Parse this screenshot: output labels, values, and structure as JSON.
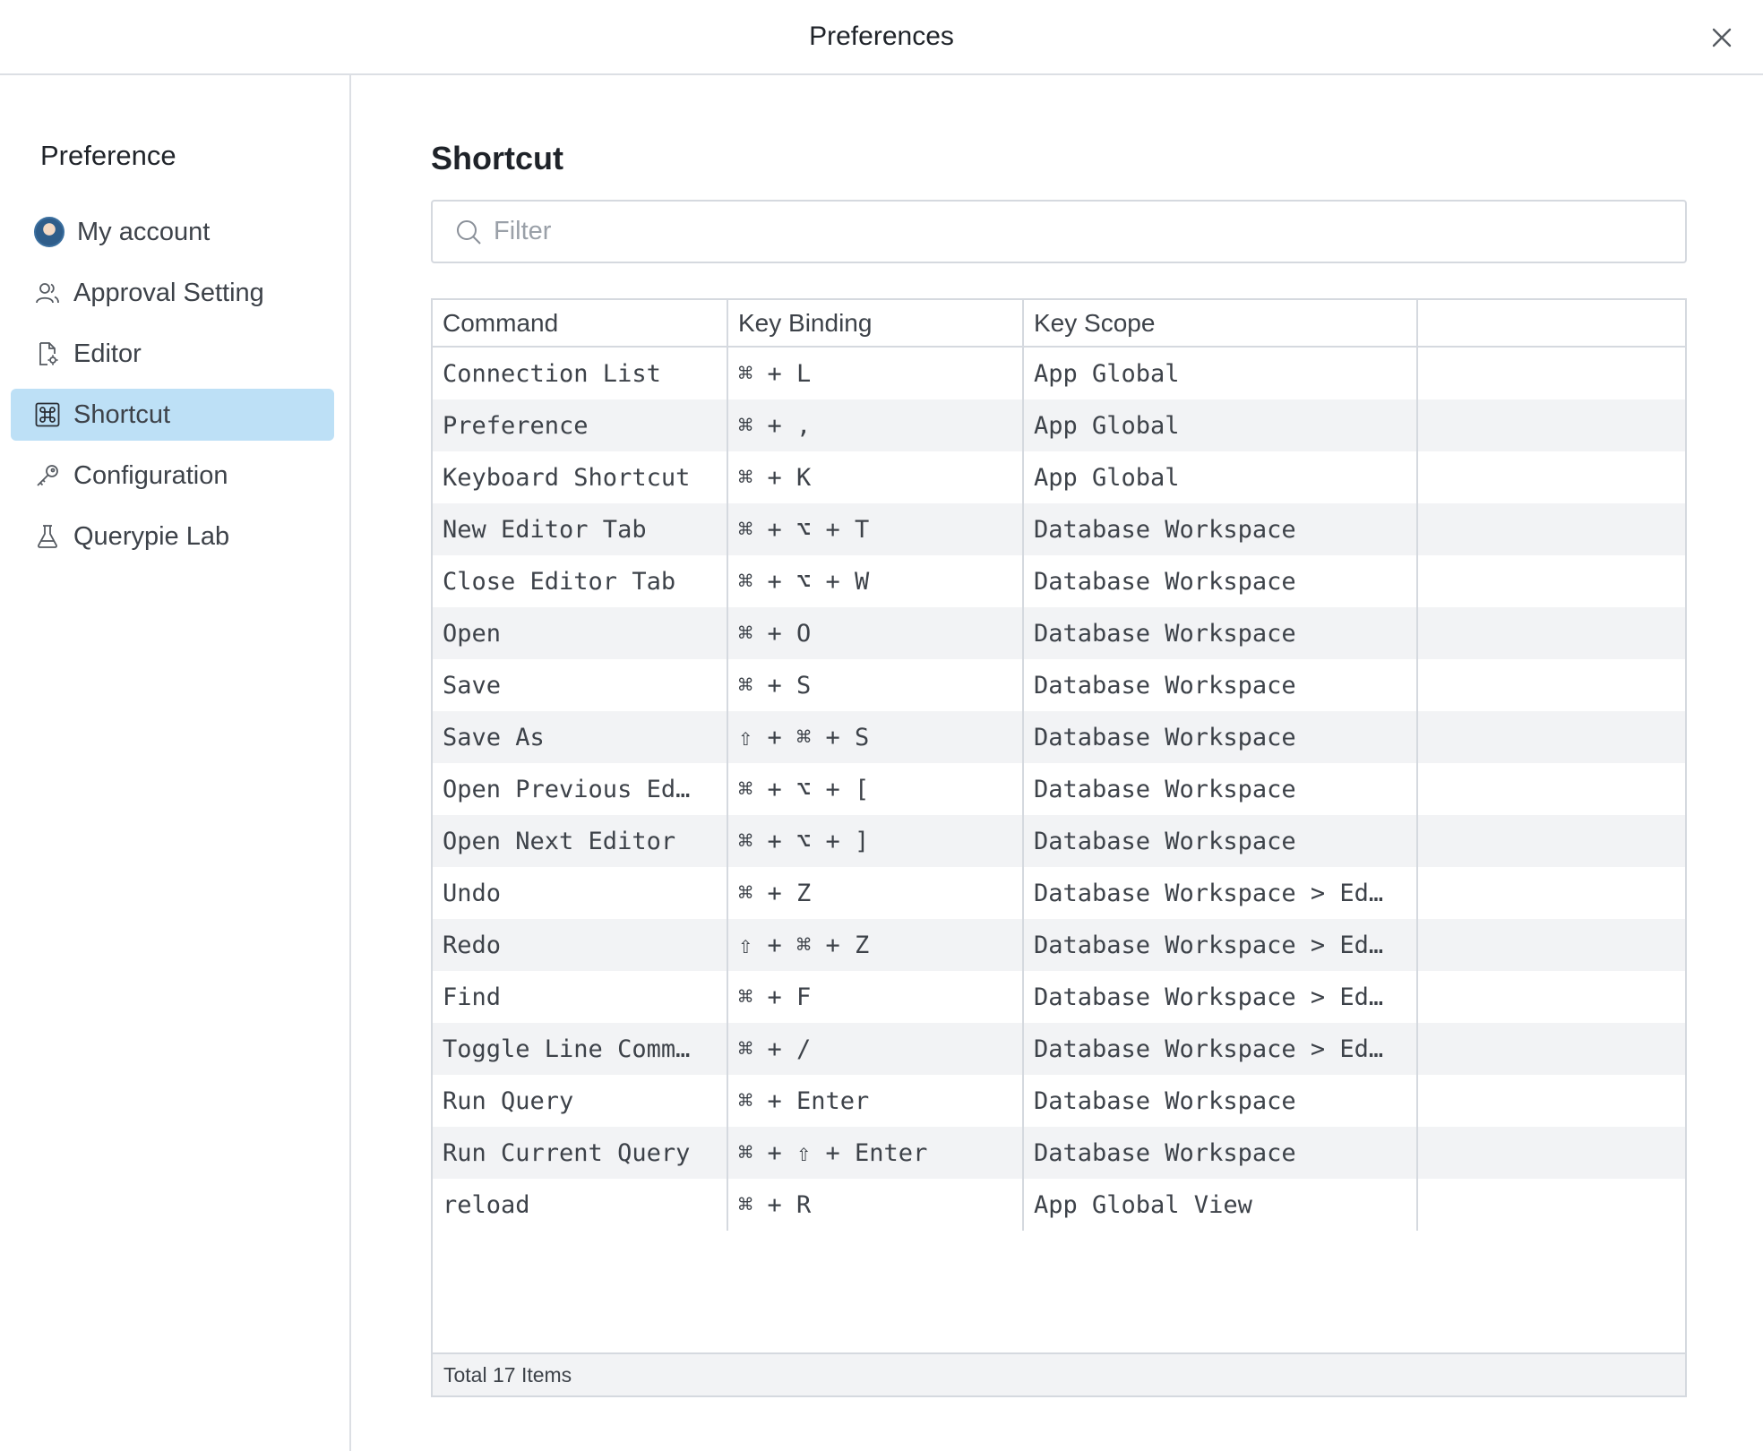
{
  "window": {
    "title": "Preferences"
  },
  "sidebar": {
    "heading": "Preference",
    "items": [
      {
        "label": "My account",
        "icon": "avatar-icon",
        "active": false
      },
      {
        "label": "Approval Setting",
        "icon": "users-icon",
        "active": false
      },
      {
        "label": "Editor",
        "icon": "file-gear-icon",
        "active": false
      },
      {
        "label": "Shortcut",
        "icon": "command-key-icon",
        "active": true
      },
      {
        "label": "Configuration",
        "icon": "key-icon",
        "active": false
      },
      {
        "label": "Querypie Lab",
        "icon": "flask-icon",
        "active": false
      }
    ]
  },
  "main": {
    "title": "Shortcut",
    "filter": {
      "placeholder": "Filter",
      "value": ""
    },
    "table": {
      "columns": [
        "Command",
        "Key Binding",
        "Key Scope",
        ""
      ],
      "rows": [
        [
          "Connection List",
          "⌘ + L",
          "App Global"
        ],
        [
          "Preference",
          "⌘ + ,",
          "App Global"
        ],
        [
          "Keyboard Shortcut",
          "⌘ + K",
          "App Global"
        ],
        [
          "New Editor Tab",
          "⌘ + ⌥ + T",
          "Database Workspace"
        ],
        [
          "Close Editor Tab",
          "⌘ + ⌥ + W",
          "Database Workspace"
        ],
        [
          "Open",
          "⌘ + O",
          "Database Workspace"
        ],
        [
          "Save",
          "⌘ + S",
          "Database Workspace"
        ],
        [
          "Save As",
          "⇧ + ⌘ + S",
          "Database Workspace"
        ],
        [
          "Open Previous Ed…",
          "⌘ + ⌥ + [",
          "Database Workspace"
        ],
        [
          "Open Next Editor",
          "⌘ + ⌥ + ]",
          "Database Workspace"
        ],
        [
          "Undo",
          "⌘ + Z",
          "Database Workspace > Ed…"
        ],
        [
          "Redo",
          "⇧ + ⌘ + Z",
          "Database Workspace > Ed…"
        ],
        [
          "Find",
          "⌘ + F",
          "Database Workspace > Ed…"
        ],
        [
          "Toggle Line Comm…",
          "⌘ + /",
          "Database Workspace > Ed…"
        ],
        [
          "Run Query",
          "⌘ + Enter",
          "Database Workspace"
        ],
        [
          "Run Current Query",
          "⌘ + ⇧ + Enter",
          "Database Workspace"
        ],
        [
          "reload",
          "⌘ + R",
          "App Global View"
        ]
      ],
      "footer": "Total 17 Items"
    }
  },
  "colors": {
    "active_nav": "#bde0f6",
    "stripe": "#f2f3f5",
    "border": "#d5d9df"
  }
}
